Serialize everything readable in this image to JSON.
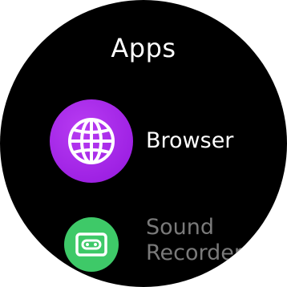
{
  "screen": {
    "title": "Apps"
  },
  "apps": [
    {
      "label": "Browser",
      "icon": "globe-icon",
      "icon_color": "#a82ee8"
    },
    {
      "label_line1": "Sound",
      "label_line2": "Recorder",
      "icon": "cassette-tape-icon",
      "icon_color": "#3ec968"
    }
  ],
  "colors": {
    "background": "#000000",
    "text_active": "#ffffff",
    "text_dimmed": "#7a7a7a"
  }
}
